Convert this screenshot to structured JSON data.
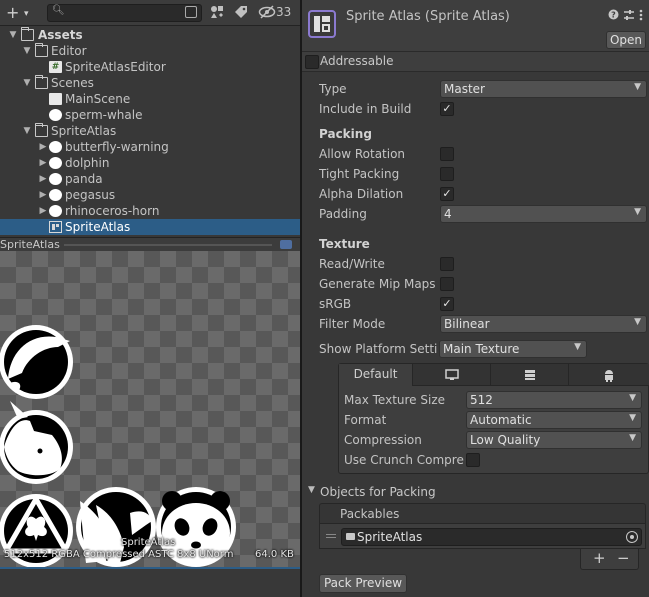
{
  "project": {
    "toolbar": {
      "add_label": "+",
      "add_caret": "▾",
      "search_placeholder": "",
      "hidden_count": "33"
    },
    "tree": [
      {
        "label": "Assets",
        "indent": 0,
        "type": "folder",
        "expanded": true,
        "bold": true
      },
      {
        "label": "Editor",
        "indent": 1,
        "type": "folder",
        "expanded": true
      },
      {
        "label": "SpriteAtlasEditor",
        "indent": 2,
        "type": "script"
      },
      {
        "label": "Scenes",
        "indent": 1,
        "type": "folder",
        "expanded": true
      },
      {
        "label": "MainScene",
        "indent": 2,
        "type": "scene"
      },
      {
        "label": "sperm-whale",
        "indent": 2,
        "type": "sprite"
      },
      {
        "label": "SpriteAtlas",
        "indent": 1,
        "type": "folder",
        "expanded": true
      },
      {
        "label": "butterfly-warning",
        "indent": 2,
        "type": "sprite",
        "collapsed": true
      },
      {
        "label": "dolphin",
        "indent": 2,
        "type": "sprite",
        "collapsed": true
      },
      {
        "label": "panda",
        "indent": 2,
        "type": "sprite",
        "collapsed": true
      },
      {
        "label": "pegasus",
        "indent": 2,
        "type": "sprite",
        "collapsed": true
      },
      {
        "label": "rhinoceros-horn",
        "indent": 2,
        "type": "sprite",
        "collapsed": true
      },
      {
        "label": "SpriteAtlas",
        "indent": 2,
        "type": "atlas",
        "selected": true
      }
    ]
  },
  "preview": {
    "header_title": "SpriteAtlas",
    "name": "SpriteAtlas",
    "info": "512x512 RGBA Compressed ASTC 8x8 UNorm",
    "size": "64.0 KB"
  },
  "inspector": {
    "title": "Sprite Atlas (Sprite Atlas)",
    "open_label": "Open",
    "addressable": {
      "label": "Addressable",
      "checked": false
    },
    "type": {
      "label": "Type",
      "value": "Master"
    },
    "include_in_build": {
      "label": "Include in Build",
      "checked": true
    },
    "packing": {
      "heading": "Packing",
      "allow_rotation": {
        "label": "Allow Rotation",
        "checked": false
      },
      "tight_packing": {
        "label": "Tight Packing",
        "checked": false
      },
      "alpha_dilation": {
        "label": "Alpha Dilation",
        "checked": true
      },
      "padding": {
        "label": "Padding",
        "value": "4"
      }
    },
    "texture": {
      "heading": "Texture",
      "read_write": {
        "label": "Read/Write",
        "checked": false
      },
      "generate_mip_maps": {
        "label": "Generate Mip Maps",
        "checked": false
      },
      "srgb": {
        "label": "sRGB",
        "checked": true
      },
      "filter_mode": {
        "label": "Filter Mode",
        "value": "Bilinear"
      }
    },
    "platform": {
      "label": "Show Platform Settir",
      "value": "Main Texture",
      "tabs": [
        "Default",
        "monitor-icon",
        "grid-icon",
        "android-icon"
      ],
      "max_texture_size": {
        "label": "Max Texture Size",
        "value": "512"
      },
      "format": {
        "label": "Format",
        "value": "Automatic"
      },
      "compression": {
        "label": "Compression",
        "value": "Low Quality"
      },
      "use_crunch": {
        "label": "Use Crunch Compres",
        "checked": false
      }
    },
    "objects_for_packing": {
      "label": "Objects for Packing",
      "list_header": "Packables",
      "items": [
        "SpriteAtlas"
      ]
    },
    "pack_preview_label": "Pack Preview"
  }
}
